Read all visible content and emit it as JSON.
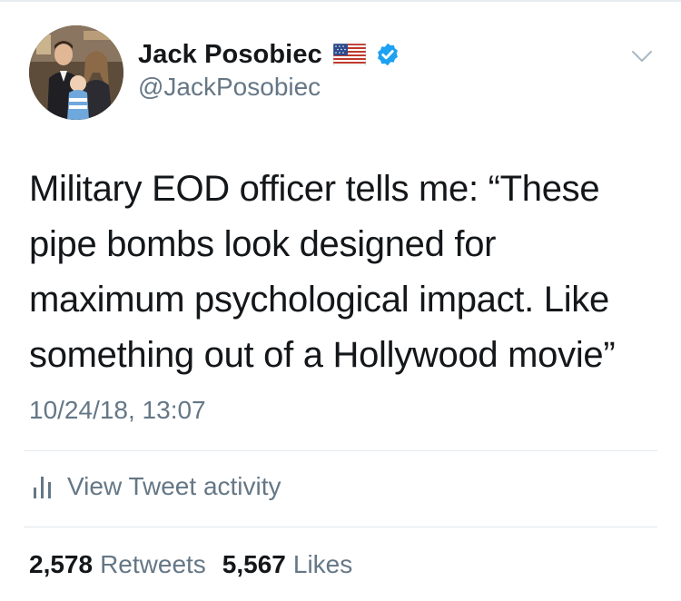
{
  "user": {
    "display_name": "Jack Posobiec",
    "handle": "@JackPosobiec",
    "flag_icon": "us-flag-icon",
    "verified_icon": "verified-badge-icon",
    "verified_color": "#1da1f2"
  },
  "tweet": {
    "text": "Military EOD officer tells me: “These\npipe bombs look designed for\nmaximum psychological impact. Like\nsomething out of a Hollywood movie”",
    "timestamp": "10/24/18, 13:07"
  },
  "activity": {
    "icon": "bar-chart-icon",
    "label": "View Tweet activity"
  },
  "stats": {
    "retweets_count": "2,578",
    "retweets_label": "Retweets",
    "likes_count": "5,567",
    "likes_label": "Likes"
  },
  "menu": {
    "icon": "chevron-down-icon"
  },
  "colors": {
    "text_primary": "#14171a",
    "text_secondary": "#657786",
    "divider": "#e1e8ed",
    "accent": "#1da1f2"
  }
}
